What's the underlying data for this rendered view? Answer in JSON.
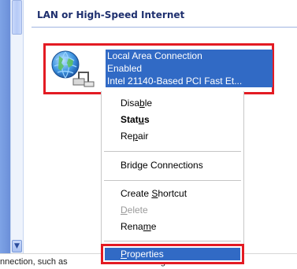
{
  "group": {
    "header": "LAN or High-Speed Internet"
  },
  "connection": {
    "name": "Local Area Connection",
    "status": "Enabled",
    "device": "Intel 21140-Based PCI Fast Et..."
  },
  "menu": {
    "disable": {
      "pre": "Disa",
      "u": "b",
      "post": "le"
    },
    "status": {
      "pre": "Stat",
      "u": "u",
      "post": "s"
    },
    "repair": {
      "pre": "Re",
      "u": "p",
      "post": "air"
    },
    "bridge": {
      "label": "Bridge Connections"
    },
    "shortcut": {
      "pre": "Create ",
      "u": "S",
      "post": "hortcut"
    },
    "delete": {
      "u": "D",
      "post": "elete"
    },
    "rename": {
      "pre": "Rena",
      "u": "m",
      "post": "e"
    },
    "properties": {
      "u": "P",
      "post": "roperties"
    }
  },
  "status_strip": {
    "left": "nnection, such as",
    "right": "config"
  }
}
